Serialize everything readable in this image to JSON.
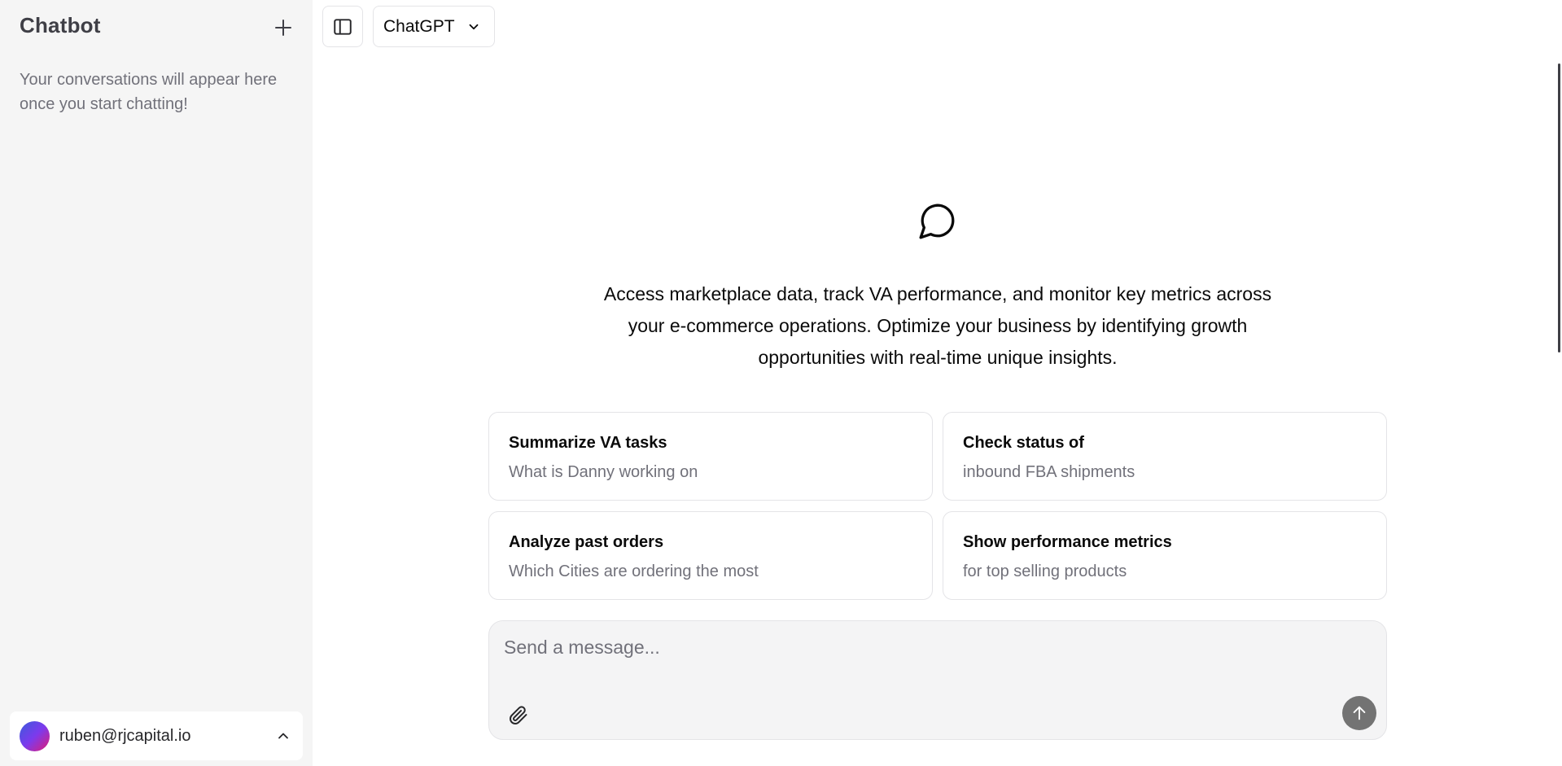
{
  "sidebar": {
    "title": "Chatbot",
    "empty_message": "Your conversations will appear here once you start chatting!",
    "new_chat_icon": "plus-icon",
    "user": {
      "email": "ruben@rjcapital.io",
      "avatar_gradient": [
        "#3b5bdb",
        "#7c3aed",
        "#e11d74"
      ],
      "menu_icon": "chevron-up-icon"
    }
  },
  "header": {
    "toggle_icon": "sidebar-toggle-icon",
    "model_selector": {
      "label": "ChatGPT",
      "icon": "chevron-down-icon"
    }
  },
  "welcome": {
    "icon": "message-circle-icon",
    "text": "Access marketplace data, track VA performance, and monitor key metrics across your e-commerce operations. Optimize your business by identifying growth opportunities with real-time unique insights."
  },
  "suggestions": [
    {
      "title": "Summarize VA tasks",
      "subtitle": "What is Danny working on"
    },
    {
      "title": "Check status of",
      "subtitle": "inbound FBA shipments"
    },
    {
      "title": "Analyze past orders",
      "subtitle": "Which Cities are ordering the most"
    },
    {
      "title": "Show performance metrics",
      "subtitle": "for top selling products"
    }
  ],
  "composer": {
    "placeholder": "Send a message...",
    "attach_icon": "paperclip-icon",
    "send_icon": "arrow-up-icon"
  },
  "colors": {
    "sidebar_bg": "#f5f5f5",
    "muted_text": "#71717a",
    "border": "#e4e4e7",
    "composer_bg": "#f4f4f5",
    "send_button": "#737373"
  }
}
